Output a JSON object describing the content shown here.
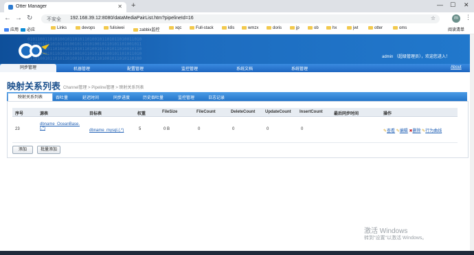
{
  "browser": {
    "tab_title": "Otter Manager",
    "security_label": "不安全",
    "url": "192.168.39.12:8080/dataMediaPairList.htm?pipelineId=16",
    "profile_initial": "m",
    "bookmarks": [
      "应用",
      "必应",
      "Links",
      "devops",
      "fulisiwei",
      "zabbix监控",
      "xqc",
      "Full-stack",
      "k8s",
      "wmzx",
      "doris",
      "jp",
      "ob",
      "hx",
      "jwt",
      "otter",
      "oms"
    ],
    "reading_list": "阅读清单"
  },
  "header": {
    "user_info": "admin （超级管理员），欢迎您进入！",
    "nav": [
      "同步管理",
      "机器管理",
      "配置管理",
      "监控管理",
      "系统文档",
      "系统管理"
    ],
    "about": "About"
  },
  "page": {
    "title": "映射关系列表",
    "breadcrumb": [
      "Channel管理",
      "Pipeline管理",
      "映射关系列表"
    ],
    "subnav": [
      "映射关系列表",
      "吞吐量",
      "延迟时间",
      "同步进度",
      "历史吞吐量",
      "监控管理",
      "日志记录"
    ]
  },
  "table": {
    "headers": [
      "序号",
      "源表",
      "目标表",
      "权重",
      "FileSize",
      "FileCount",
      "DeleteCount",
      "UpdateCount",
      "InsertCount",
      "最后同步时间",
      "操作"
    ],
    "rows": [
      {
        "id": "23",
        "source": "dbname_OceanBase.(.*)",
        "target": "dbname_mysql.(.*)",
        "weight": "5",
        "filesize": "0 B",
        "filecount": "0",
        "deletecount": "0",
        "updatecount": "0",
        "insertcount": "0",
        "last_sync": "",
        "actions": [
          "查看",
          "编辑",
          "删除",
          "行为曲线"
        ]
      }
    ]
  },
  "buttons": {
    "add": "添加",
    "batch_add": "批量添加"
  },
  "watermark": {
    "line1": "激活 Windows",
    "line2": "转到\"设置\"以激活 Windows。"
  }
}
